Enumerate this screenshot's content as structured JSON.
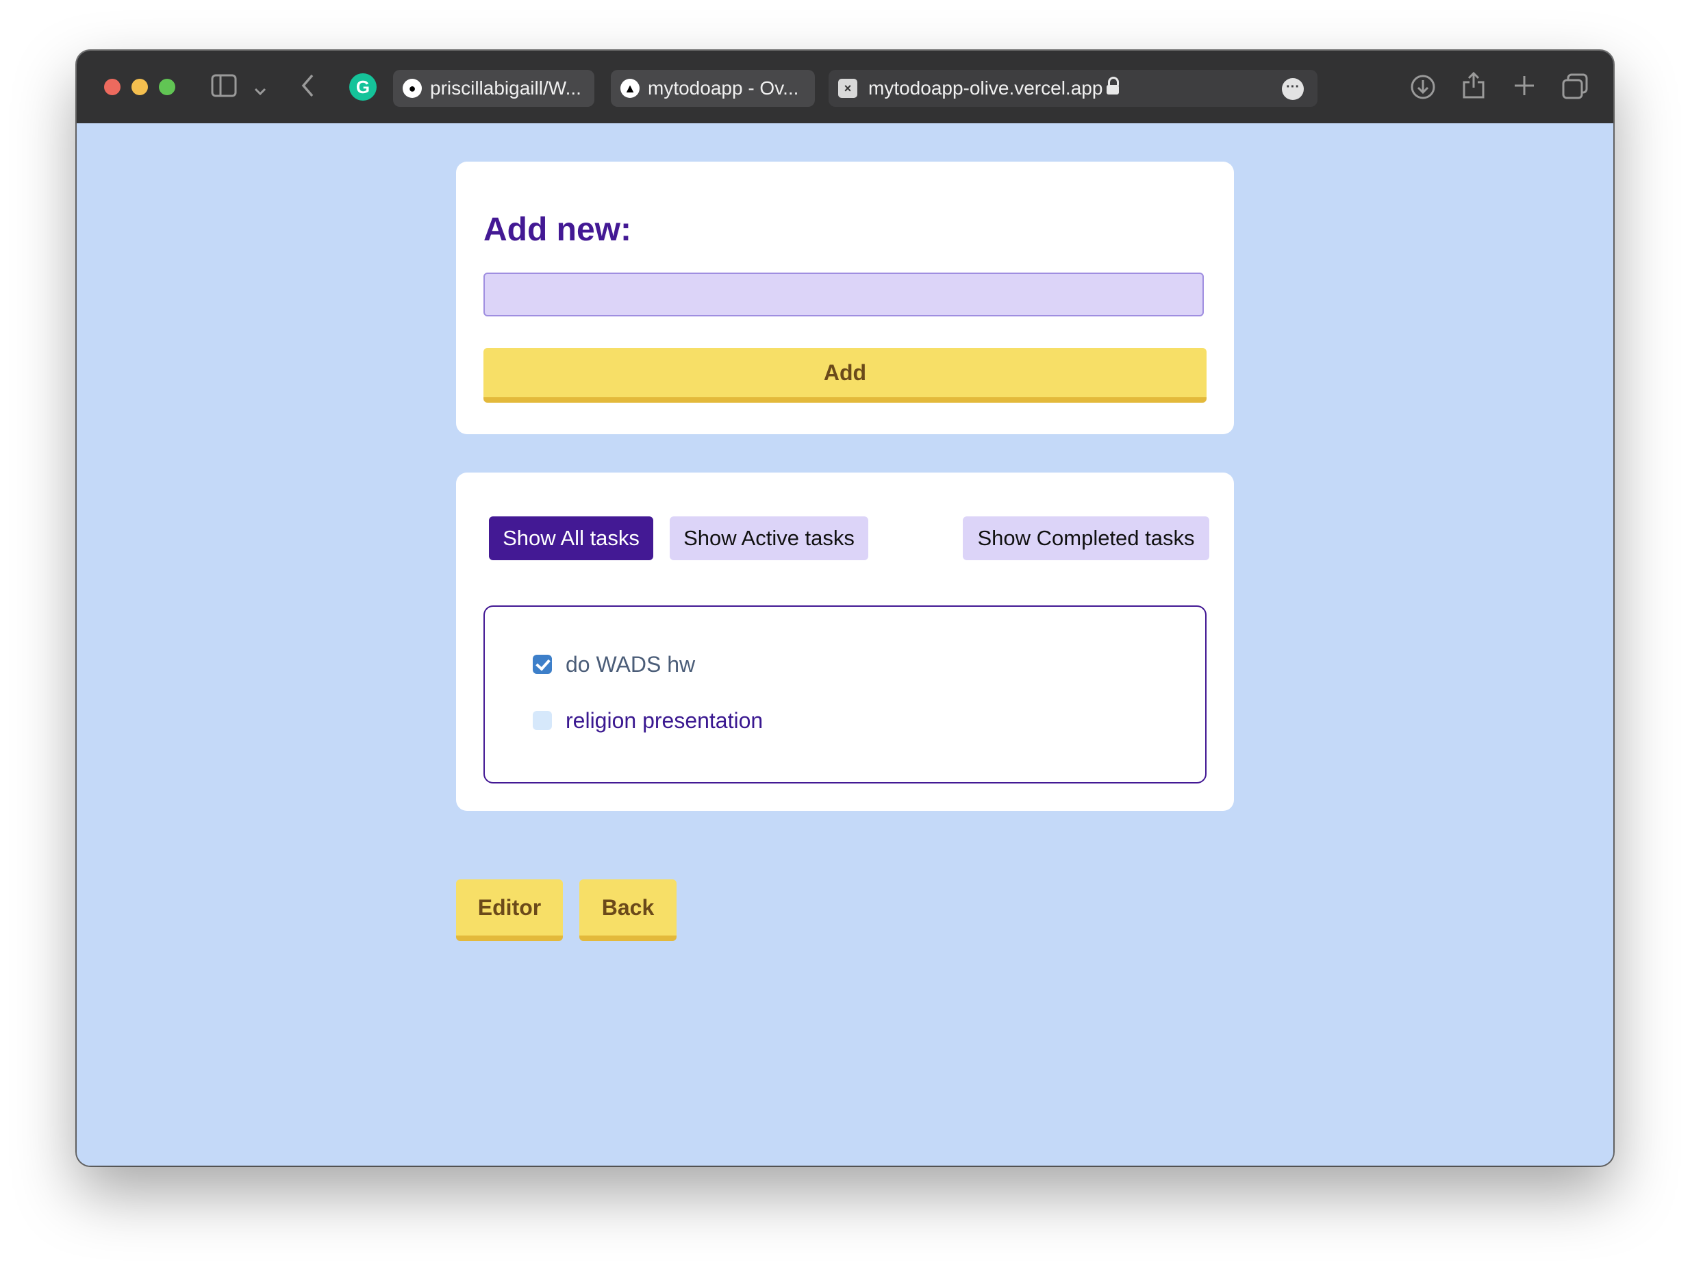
{
  "browser": {
    "tabs": [
      {
        "label": "priscillabigaill/W...",
        "icon": "github-icon"
      },
      {
        "label": "mytodoapp - Ov...",
        "icon": "vercel-icon"
      }
    ],
    "address": {
      "url": "mytodoapp-olive.vercel.app",
      "icon": "site-icon"
    }
  },
  "add_card": {
    "heading": "Add new:",
    "input_value": "",
    "add_label": "Add"
  },
  "filters": [
    {
      "label": "Show All tasks",
      "active": true
    },
    {
      "label": "Show Active tasks",
      "active": false
    },
    {
      "label": "Show Completed tasks",
      "active": false
    }
  ],
  "tasks": [
    {
      "text": "do WADS hw",
      "completed": true
    },
    {
      "text": "religion presentation",
      "completed": false
    }
  ],
  "footer": {
    "editor_label": "Editor",
    "back_label": "Back"
  },
  "colors": {
    "page_bg": "#c4d9f8",
    "accent_purple": "#431994",
    "button_yellow": "#f7df67",
    "input_lavender": "#dcd4f8"
  }
}
